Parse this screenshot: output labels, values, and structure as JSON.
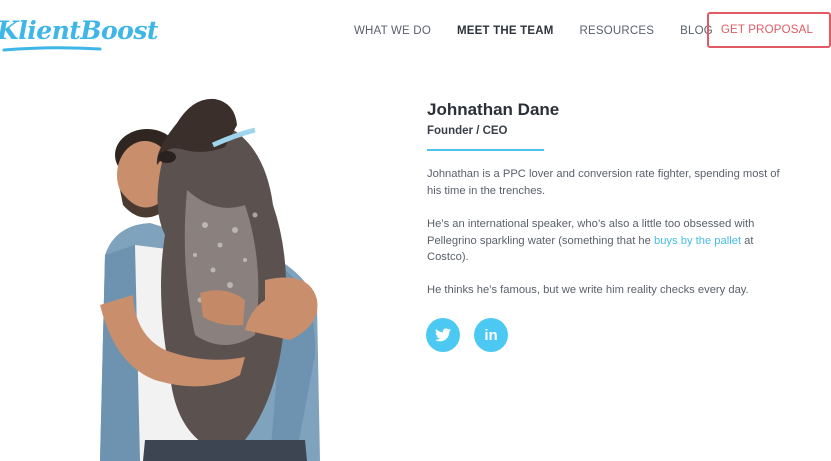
{
  "brand": {
    "logo_text": "KlientBoost",
    "accent": "#3fb6e8",
    "cta_color": "#e05a63"
  },
  "nav": {
    "items": [
      {
        "label": "WHAT WE DO",
        "active": false
      },
      {
        "label": "MEET THE TEAM",
        "active": true
      },
      {
        "label": "RESOURCES",
        "active": false
      },
      {
        "label": "BLOG",
        "active": false
      }
    ],
    "cta_label": "GET PROPOSAL"
  },
  "profile": {
    "name": "Johnathan Dane",
    "role": "Founder / CEO",
    "bio_1": "Johnathan is a PPC lover and conversion rate fighter, spending most of his time in the trenches.",
    "bio_2_before": "He’s an international speaker, who’s also a little too obsessed with Pellegrino sparkling water (something that he ",
    "bio_2_link": "buys by the pallet",
    "bio_2_after": " at Costco).",
    "bio_3": "He thinks he’s famous, but we write him reality checks every day.",
    "photo_icon": "person-holding-dog-photo"
  },
  "social": [
    {
      "icon": "twitter-icon"
    },
    {
      "icon": "linkedin-icon",
      "label": "in"
    }
  ]
}
